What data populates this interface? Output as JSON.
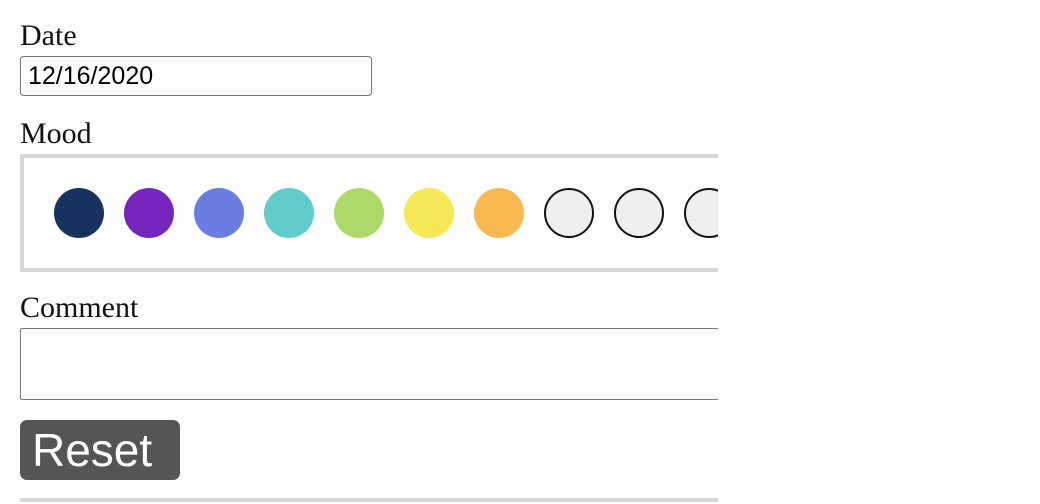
{
  "form": {
    "date_label": "Date",
    "date_value": "12/16/2020",
    "mood_label": "Mood",
    "comment_label": "Comment",
    "comment_value": "",
    "reset_label": "Reset"
  },
  "mood": {
    "swatches": [
      {
        "color": "#17325e",
        "state": "filled"
      },
      {
        "color": "#7527bd",
        "state": "filled"
      },
      {
        "color": "#6a7de0",
        "state": "filled"
      },
      {
        "color": "#60cccc",
        "state": "filled"
      },
      {
        "color": "#abda68",
        "state": "filled"
      },
      {
        "color": "#f6e857",
        "state": "filled"
      },
      {
        "color": "#f8b84f",
        "state": "filled"
      },
      {
        "color": "#efefef",
        "state": "empty"
      },
      {
        "color": "#efefef",
        "state": "empty"
      },
      {
        "color": "#efefef",
        "state": "empty"
      }
    ]
  }
}
